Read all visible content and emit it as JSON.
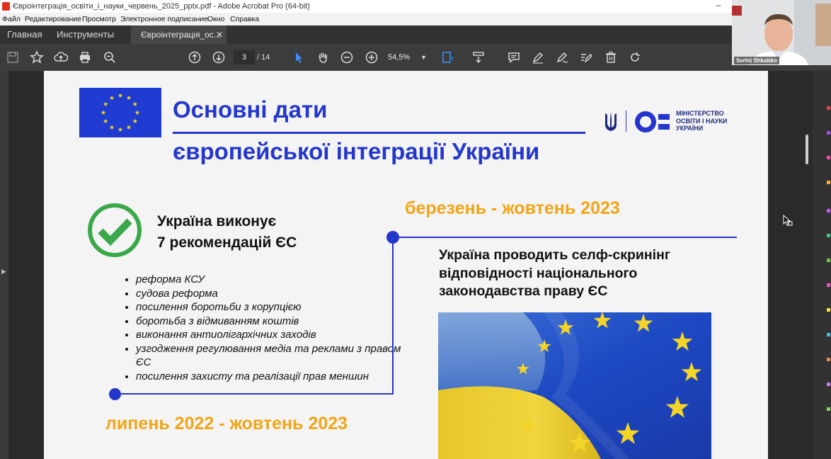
{
  "window": {
    "title": "Євроінтеграція_освіти_і_науки_червень_2025_pptx.pdf - Adobe Acrobat Pro (64-bit)"
  },
  "menu": [
    "Файл",
    "Редактирование",
    "Просмотр",
    "Электронное подписание",
    "Окно",
    "Справка"
  ],
  "tabs": {
    "home": "Главная",
    "tools": "Инструменты",
    "document": "Євроінтеграція_ос..."
  },
  "toolbar": {
    "page_current": "3",
    "page_total": "/ 14",
    "zoom": "54,5%"
  },
  "slide": {
    "title_line1": "Основні дати",
    "title_line2": "європейської інтеграції України",
    "ministry": [
      "МІНІСТЕРСТВО",
      "ОСВІТИ І НАУКИ",
      "УКРАЇНИ"
    ],
    "recommendations_title": [
      "Україна виконує",
      "7 рекомендацій ЄС"
    ],
    "recommendations": [
      "реформа КСУ",
      "судова реформа",
      "посилення боротьби з корупцією",
      "боротьба з відмиванням коштів",
      "виконання антиолігархічних заходів",
      "узгодження регулювання медіа та реклами з правом ЄС",
      "посилення захисту та реалізації прав меншин"
    ],
    "date_top": "березень - жовтень 2023",
    "date_bottom": "липень 2022 - жовтень 2023",
    "screening_text": [
      "Україна проводить селф-скринінг",
      "відповідності національного",
      "законодавства праву ЄС"
    ]
  },
  "webcam": {
    "name": "Serhii Shkabko"
  },
  "colors": {
    "accent_blue": "#2437cc",
    "accent_orange": "#f2a516",
    "check_green": "#3aa84a"
  }
}
